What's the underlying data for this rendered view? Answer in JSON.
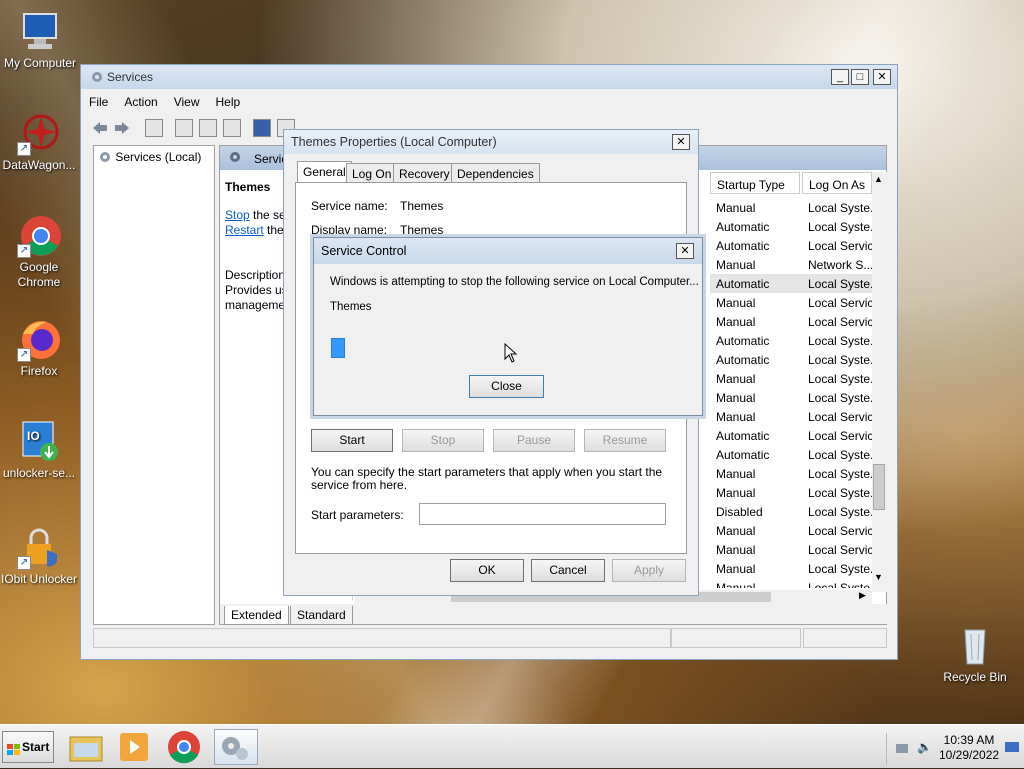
{
  "desktop": {
    "icons": [
      {
        "label": "My Computer"
      },
      {
        "label": "DataWagon..."
      },
      {
        "label": "Google Chrome"
      },
      {
        "label": "Firefox"
      },
      {
        "label": "unlocker-se..."
      },
      {
        "label": "IObit Unlocker"
      },
      {
        "label": "Recycle Bin"
      }
    ]
  },
  "services_window": {
    "title": "Services",
    "menu": [
      "File",
      "Action",
      "View",
      "Help"
    ],
    "tree_item": "Services (Local)",
    "header_title": "Services",
    "selected_service": "Themes",
    "stop_link": "Stop",
    "stop_rest": "the service",
    "restart_link": "Restart",
    "restart_rest": "the service",
    "description_label": "Description:",
    "description_line1": "Provides user experience theme",
    "description_line2": "management.",
    "columns": {
      "startup_type": "Startup Type",
      "log_on_as": "Log On As"
    },
    "rows": [
      {
        "startup": "Manual",
        "logon": "Local Syste..."
      },
      {
        "startup": "Automatic",
        "logon": "Local Syste..."
      },
      {
        "startup": "Automatic",
        "logon": "Local Servic"
      },
      {
        "startup": "Manual",
        "logon": "Network S..."
      },
      {
        "startup": "Automatic",
        "logon": "Local Syste..."
      },
      {
        "startup": "Manual",
        "logon": "Local Servic"
      },
      {
        "startup": "Manual",
        "logon": "Local Servic"
      },
      {
        "startup": "Automatic",
        "logon": "Local Syste..."
      },
      {
        "startup": "Automatic",
        "logon": "Local Syste..."
      },
      {
        "startup": "Manual",
        "logon": "Local Syste..."
      },
      {
        "startup": "Manual",
        "logon": "Local Syste..."
      },
      {
        "startup": "Manual",
        "logon": "Local Servic"
      },
      {
        "startup": "Automatic",
        "logon": "Local Servic"
      },
      {
        "startup": "Automatic",
        "logon": "Local Syste..."
      },
      {
        "startup": "Manual",
        "logon": "Local Syste..."
      },
      {
        "startup": "Manual",
        "logon": "Local Syste..."
      },
      {
        "startup": "Disabled",
        "logon": "Local Syste..."
      },
      {
        "startup": "Manual",
        "logon": "Local Servic"
      },
      {
        "startup": "Manual",
        "logon": "Local Servic"
      },
      {
        "startup": "Manual",
        "logon": "Local Syste..."
      },
      {
        "startup": "Manual",
        "logon": "Local Syste..."
      }
    ],
    "bottom_tabs": [
      "Extended",
      "Standard"
    ]
  },
  "properties_dialog": {
    "title": "Themes Properties (Local Computer)",
    "tabs": [
      "General",
      "Log On",
      "Recovery",
      "Dependencies"
    ],
    "service_name_label": "Service name:",
    "service_name_value": "Themes",
    "display_name_label": "Display name:",
    "display_name_value": "Themes",
    "buttons": {
      "start": "Start",
      "stop": "Stop",
      "pause": "Pause",
      "resume": "Resume"
    },
    "params_hint": "You can specify the start parameters that apply when you start the service from here.",
    "start_params_label": "Start parameters:",
    "start_params_value": "",
    "ok": "OK",
    "cancel": "Cancel",
    "apply": "Apply"
  },
  "service_control": {
    "title": "Service Control",
    "message": "Windows is attempting to stop the following service on Local Computer...",
    "service": "Themes",
    "close": "Close"
  },
  "taskbar": {
    "start": "Start",
    "time": "10:39 AM",
    "date": "10/29/2022"
  },
  "colors": {
    "accent": "#3399ff",
    "title_bar": "#c6d7ec",
    "link": "#0b5ec9"
  }
}
